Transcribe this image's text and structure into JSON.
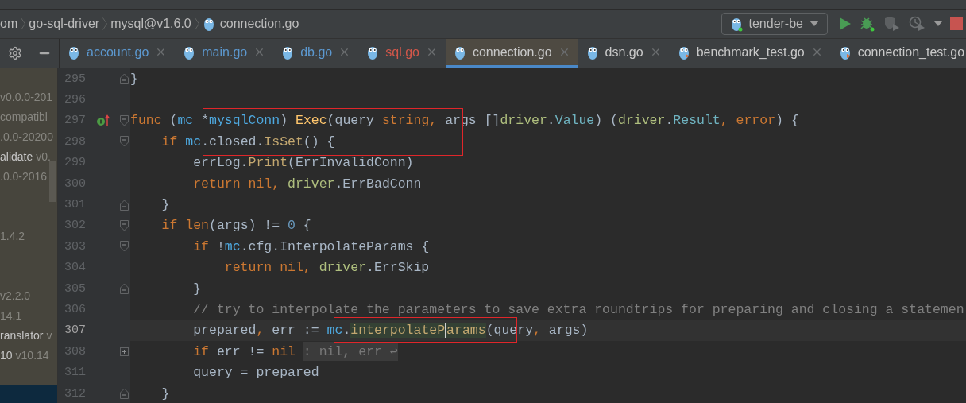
{
  "breadcrumb": [
    {
      "label": "om",
      "kind": "folder"
    },
    {
      "label": "go-sql-driver",
      "kind": "folder"
    },
    {
      "label": "mysql@v1.6.0",
      "kind": "folder"
    },
    {
      "label": "connection.go",
      "kind": "file"
    }
  ],
  "run_config": {
    "label": "tender-be"
  },
  "tabs": [
    {
      "label": "account.go",
      "kind": "source",
      "color": "#5c98cf",
      "selected": false,
      "closable": true
    },
    {
      "label": "main.go",
      "kind": "source",
      "color": "#5c98cf",
      "selected": false,
      "closable": true
    },
    {
      "label": "db.go",
      "kind": "source",
      "color": "#5c98cf",
      "selected": false,
      "closable": true
    },
    {
      "label": "sql.go",
      "kind": "source",
      "color": "#d2574a",
      "selected": false,
      "closable": true
    },
    {
      "label": "connection.go",
      "kind": "source",
      "color": "#c9c9c9",
      "selected": true,
      "closable": true
    },
    {
      "label": "dsn.go",
      "kind": "source",
      "color": "#c9c9c9",
      "selected": false,
      "closable": true
    },
    {
      "label": "benchmark_test.go",
      "kind": "test",
      "color": "#c9c9c9",
      "selected": false,
      "closable": true
    },
    {
      "label": "connection_test.go",
      "kind": "test",
      "color": "#c9c9c9",
      "selected": false,
      "closable": false
    }
  ],
  "project_tree": [
    {
      "selected": false,
      "parts": [
        {
          "text": "v0.0.0-201",
          "kind": "version"
        }
      ]
    },
    {
      "selected": false,
      "parts": [
        {
          "text": "compatibl",
          "kind": "version"
        }
      ]
    },
    {
      "selected": false,
      "parts": [
        {
          "text": ".0.0-20200",
          "kind": "version"
        }
      ]
    },
    {
      "selected": false,
      "parts": [
        {
          "text": "alidate",
          "kind": "name"
        },
        {
          "text": "v0.",
          "kind": "version"
        }
      ]
    },
    {
      "selected": false,
      "parts": [
        {
          "text": ".0.0-2016",
          "kind": "version"
        }
      ]
    },
    {
      "selected": false
    },
    {
      "selected": false
    },
    {
      "selected": false,
      "parts": [
        {
          "text": "1.4.2",
          "kind": "version"
        }
      ]
    },
    {
      "selected": false
    },
    {
      "selected": false
    },
    {
      "selected": false,
      "parts": [
        {
          "text": "v2.2.0",
          "kind": "version"
        }
      ]
    },
    {
      "selected": false,
      "parts": [
        {
          "text": "14.1",
          "kind": "version"
        }
      ]
    },
    {
      "selected": false,
      "parts": [
        {
          "text": "ranslator",
          "kind": "name"
        },
        {
          "text": "v",
          "kind": "version"
        }
      ]
    },
    {
      "selected": false,
      "parts": [
        {
          "text": "10",
          "kind": "name"
        },
        {
          "text": "v10.14",
          "kind": "version"
        }
      ]
    },
    {
      "selected": false
    },
    {
      "selected": true
    }
  ],
  "code_lines": [
    {
      "number": "295",
      "fold": {
        "kind": "end"
      },
      "current": false,
      "tokens": [
        {
          "text": "}",
          "kind": "plain"
        }
      ]
    },
    {
      "number": "296",
      "current": false
    },
    {
      "number": "297",
      "fold": {
        "kind": "start"
      },
      "marker": {
        "kind": "implements"
      },
      "current": false,
      "tokens": [
        {
          "text": "func ",
          "kind": "kw"
        },
        {
          "text": "(",
          "kind": "plain"
        },
        {
          "text": "mc",
          "kind": "recv"
        },
        {
          "text": " *",
          "kind": "plain"
        },
        {
          "text": "mysqlConn",
          "kind": "recv"
        },
        {
          "text": ") ",
          "kind": "plain"
        },
        {
          "text": "Exec",
          "kind": "fn"
        },
        {
          "text": "(query ",
          "kind": "plain"
        },
        {
          "text": "string, ",
          "kind": "kw"
        },
        {
          "text": "args []",
          "kind": "plain"
        },
        {
          "text": "driver",
          "kind": "pkg"
        },
        {
          "text": ".",
          "kind": "plain"
        },
        {
          "text": "Value",
          "kind": "type"
        },
        {
          "text": ") (",
          "kind": "plain"
        },
        {
          "text": "driver",
          "kind": "pkg"
        },
        {
          "text": ".",
          "kind": "plain"
        },
        {
          "text": "Result",
          "kind": "type"
        },
        {
          "text": ", ",
          "kind": "kw"
        },
        {
          "text": "error",
          "kind": "kw"
        },
        {
          "text": ") {",
          "kind": "plain"
        }
      ]
    },
    {
      "number": "298",
      "fold": {
        "kind": "start"
      },
      "current": false,
      "tokens": [
        {
          "text": "    if ",
          "kind": "kw"
        },
        {
          "text": "mc",
          "kind": "recv"
        },
        {
          "text": ".closed.",
          "kind": "plain"
        },
        {
          "text": "IsSet",
          "kind": "call"
        },
        {
          "text": "() {",
          "kind": "plain"
        }
      ]
    },
    {
      "number": "299",
      "current": false,
      "tokens": [
        {
          "text": "        errLog.",
          "kind": "plain"
        },
        {
          "text": "Print",
          "kind": "call"
        },
        {
          "text": "(ErrInvalidConn)",
          "kind": "plain"
        }
      ]
    },
    {
      "number": "300",
      "current": false,
      "tokens": [
        {
          "text": "        return nil, ",
          "kind": "kw"
        },
        {
          "text": "driver",
          "kind": "pkg"
        },
        {
          "text": ".ErrBadConn",
          "kind": "plain"
        }
      ]
    },
    {
      "number": "301",
      "fold": {
        "kind": "end"
      },
      "current": false,
      "tokens": [
        {
          "text": "    }",
          "kind": "plain"
        }
      ]
    },
    {
      "number": "302",
      "fold": {
        "kind": "start"
      },
      "current": false,
      "tokens": [
        {
          "text": "    if ",
          "kind": "kw"
        },
        {
          "text": "len",
          "kind": "kw"
        },
        {
          "text": "(args) != ",
          "kind": "plain"
        },
        {
          "text": "0",
          "kind": "num"
        },
        {
          "text": " {",
          "kind": "plain"
        }
      ]
    },
    {
      "number": "303",
      "fold": {
        "kind": "start"
      },
      "current": false,
      "tokens": [
        {
          "text": "        if ",
          "kind": "kw"
        },
        {
          "text": "!",
          "kind": "plain"
        },
        {
          "text": "mc",
          "kind": "recv"
        },
        {
          "text": ".cfg.InterpolateParams {",
          "kind": "plain"
        }
      ]
    },
    {
      "number": "304",
      "current": false,
      "tokens": [
        {
          "text": "            return nil, ",
          "kind": "kw"
        },
        {
          "text": "driver",
          "kind": "pkg"
        },
        {
          "text": ".ErrSkip",
          "kind": "plain"
        }
      ]
    },
    {
      "number": "305",
      "fold": {
        "kind": "end"
      },
      "current": false,
      "tokens": [
        {
          "text": "        }",
          "kind": "plain"
        }
      ]
    },
    {
      "number": "306",
      "current": false,
      "tokens": [
        {
          "text": "        // try to interpolate the parameters to save extra roundtrips for preparing and closing a statemen",
          "kind": "comment"
        }
      ]
    },
    {
      "number": "307",
      "current": true,
      "tokens": [
        {
          "text": "        prepared",
          "kind": "plain"
        },
        {
          "text": ", ",
          "kind": "kw"
        },
        {
          "text": "err := ",
          "kind": "plain"
        },
        {
          "text": "mc",
          "kind": "recv"
        },
        {
          "text": ".",
          "kind": "plain"
        },
        {
          "text": "interpolateP",
          "kind": "usage"
        },
        {
          "text": "arams",
          "kind": "usage",
          "caret": true
        },
        {
          "text": "(query",
          "kind": "plain"
        },
        {
          "text": ", ",
          "kind": "kw"
        },
        {
          "text": "args)",
          "kind": "plain"
        }
      ]
    },
    {
      "number": "308",
      "fold": {
        "kind": "collapsed"
      },
      "current": false,
      "tokens": [
        {
          "text": "        if ",
          "kind": "kw"
        },
        {
          "text": "err != ",
          "kind": "plain"
        },
        {
          "text": "nil ",
          "kind": "kw"
        },
        {
          "text": ": nil, err ↩",
          "kind": "hint"
        }
      ]
    },
    {
      "number": "311",
      "current": false,
      "tokens": [
        {
          "text": "        query = prepared",
          "kind": "plain"
        }
      ]
    },
    {
      "number": "312",
      "fold": {
        "kind": "end"
      },
      "current": false,
      "tokens": [
        {
          "text": "    }",
          "kind": "plain"
        }
      ]
    }
  ]
}
